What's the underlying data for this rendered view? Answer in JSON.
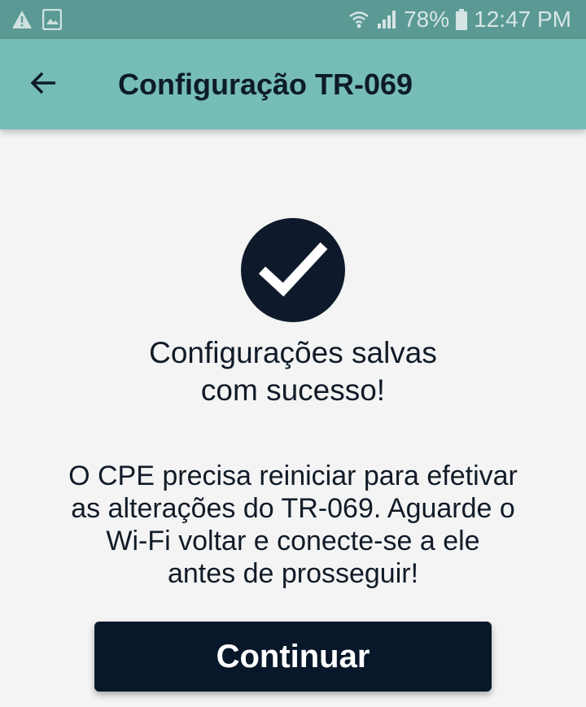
{
  "status_bar": {
    "left_icons": [
      "warning-icon",
      "image-icon"
    ],
    "battery_percent": "78%",
    "time": "12:47 PM",
    "right_icons": [
      "wifi-icon",
      "signal-icon",
      "battery-icon"
    ]
  },
  "app_bar": {
    "back_icon": "arrow-left-icon",
    "title": "Configuração TR-069",
    "color": "#76bdb5"
  },
  "main": {
    "success_icon": "check-circle-icon",
    "success_line1": "Configurações salvas",
    "success_line2": "com sucesso!",
    "info_line1": "O CPE precisa reiniciar para efetivar",
    "info_line2": "as alterações do TR-069. Aguarde o",
    "info_line3": "Wi-Fi voltar e conecte-se a ele",
    "info_line4": "antes de prosseguir!",
    "continue_label": "Continuar",
    "accent_dark": "#0e1a2b"
  }
}
